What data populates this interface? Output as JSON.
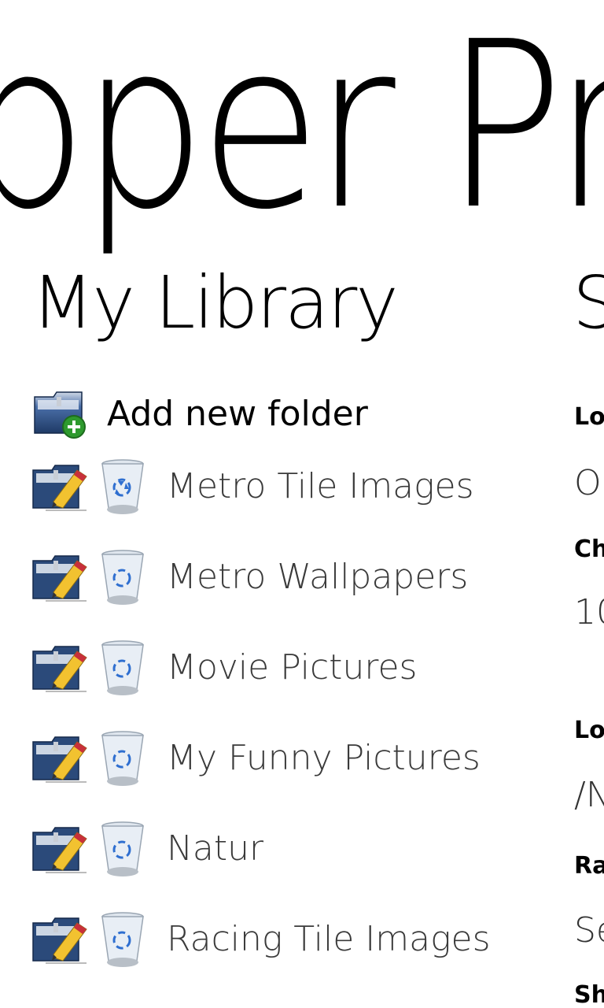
{
  "app": {
    "panorama_title": "pper Pro"
  },
  "library": {
    "title": "My Library",
    "add_label": "Add new folder",
    "folders": [
      {
        "name": "Metro Tile Images"
      },
      {
        "name": "Metro Wallpapers"
      },
      {
        "name": "Movie Pictures"
      },
      {
        "name": "My Funny Pictures"
      },
      {
        "name": "Natur"
      },
      {
        "name": "Racing Tile Images"
      }
    ]
  },
  "settings": {
    "title": "S",
    "items": [
      {
        "label": "Lo",
        "value": "O"
      },
      {
        "label": "Ch",
        "value": "10"
      },
      {
        "label": "Lo",
        "value": "/N"
      },
      {
        "label": "Ra",
        "value": "Se"
      },
      {
        "label": "Sh",
        "value": ""
      }
    ]
  },
  "icons": {
    "add": "folder-add-icon",
    "edit": "folder-edit-icon",
    "delete": "recycle-bin-icon"
  },
  "colors": {
    "folder_blue": "#2b4a7a",
    "plus_green": "#2e9a2e",
    "pencil_yellow": "#f2c230",
    "pencil_red": "#c8303a",
    "recycle_blue": "#2f6fd0"
  }
}
